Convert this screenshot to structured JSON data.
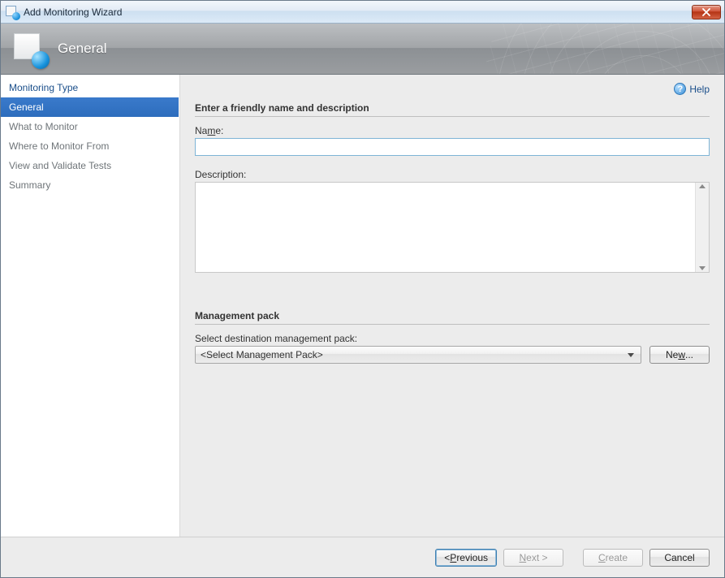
{
  "window": {
    "title": "Add Monitoring Wizard"
  },
  "banner": {
    "title": "General"
  },
  "help": {
    "label": "Help"
  },
  "sidebar": {
    "items": [
      {
        "label": "Monitoring Type",
        "state": "link"
      },
      {
        "label": "General",
        "state": "selected"
      },
      {
        "label": "What to Monitor",
        "state": "inactive"
      },
      {
        "label": "Where to Monitor From",
        "state": "inactive"
      },
      {
        "label": "View and Validate Tests",
        "state": "inactive"
      },
      {
        "label": "Summary",
        "state": "inactive"
      }
    ]
  },
  "sections": {
    "friendly": {
      "title": "Enter a friendly name and description",
      "name_prefix": "Na",
      "name_ul": "m",
      "name_suffix": "e:",
      "name_value": "",
      "desc_label": "Description:",
      "desc_value": ""
    },
    "mp": {
      "title": "Management pack",
      "select_label": "Select destination management pack:",
      "combo_value": "<Select Management Pack>",
      "new_prefix": "Ne",
      "new_ul": "w",
      "new_suffix": "..."
    }
  },
  "footer": {
    "previous_lt": "< ",
    "previous_ul": "P",
    "previous_rest": "revious",
    "next_ul": "N",
    "next_rest": "ext >",
    "create_ul": "C",
    "create_rest": "reate",
    "cancel": "Cancel"
  }
}
